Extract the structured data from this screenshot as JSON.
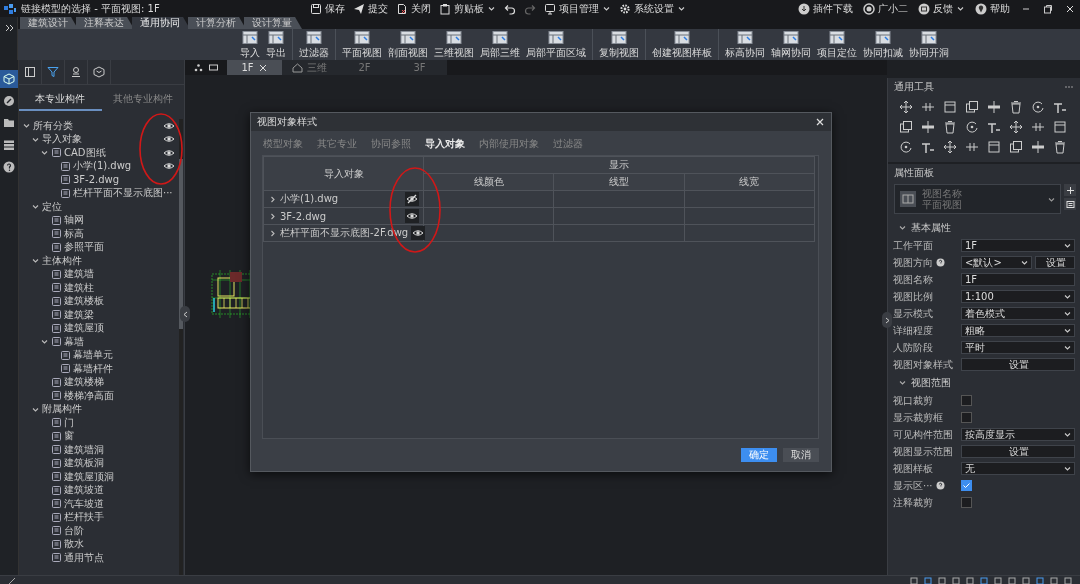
{
  "window": {
    "title": "链接模型的选择 - 平面视图: 1F"
  },
  "quick_menu": [
    {
      "kind": "save",
      "label": "保存",
      "dropdown": false,
      "disabled": false
    },
    {
      "kind": "submit",
      "label": "提交",
      "dropdown": false,
      "disabled": false
    },
    {
      "kind": "close",
      "label": "关闭",
      "dropdown": false,
      "disabled": false
    },
    {
      "kind": "clipboard",
      "label": "剪贴板",
      "dropdown": true,
      "disabled": false
    },
    {
      "kind": "undo",
      "dropdown": false,
      "disabled": false
    },
    {
      "kind": "redo",
      "dropdown": false,
      "disabled": true
    },
    {
      "kind": "project",
      "label": "项目管理",
      "dropdown": true,
      "disabled": false
    },
    {
      "kind": "settings",
      "label": "系统设置",
      "dropdown": true,
      "disabled": false
    }
  ],
  "help_menu": [
    {
      "kind": "plugin",
      "label": "插件下载",
      "dropdown": false
    },
    {
      "kind": "assistant",
      "label": "广小二",
      "dropdown": false
    },
    {
      "kind": "feedback",
      "label": "反馈",
      "dropdown": true
    },
    {
      "kind": "help",
      "label": "帮助",
      "dropdown": false
    }
  ],
  "ribbon": {
    "tabs": [
      {
        "label": "建筑设计",
        "selected": false
      },
      {
        "label": "注释表达",
        "selected": false
      },
      {
        "label": "通用协同",
        "selected": true
      },
      {
        "label": "计算分析",
        "selected": false
      },
      {
        "label": "设计算量",
        "selected": false
      }
    ],
    "groups": [
      [
        "导入",
        "导出"
      ],
      [
        "过滤器"
      ],
      [
        "平面视图",
        "剖面视图",
        "三维视图",
        "局部三维",
        "局部平面区域"
      ],
      [
        "复制视图"
      ],
      [
        "创建视图样板"
      ],
      [
        "标高协同",
        "轴网协同",
        "项目定位",
        "协同扣减",
        "协同开洞"
      ]
    ]
  },
  "nav_rail": [
    {
      "kind": "cube",
      "selected": true
    },
    {
      "kind": "link",
      "selected": false
    },
    {
      "kind": "folder",
      "selected": false
    },
    {
      "kind": "list",
      "selected": false
    },
    {
      "kind": "help",
      "selected": false
    }
  ],
  "left_panel": {
    "view_tabs": [
      {
        "kind": "layout",
        "selected": false
      },
      {
        "kind": "filter",
        "selected": true
      },
      {
        "kind": "stamp",
        "selected": false
      },
      {
        "kind": "box",
        "selected": false
      }
    ],
    "tabs": [
      {
        "label": "本专业构件",
        "selected": true
      },
      {
        "label": "其他专业构件",
        "selected": false
      }
    ],
    "tree": [
      {
        "label": "所有分类",
        "eye": true,
        "expanded": true,
        "children": [
          {
            "label": "导入对象",
            "eye": true,
            "expanded": true,
            "children": [
              {
                "label": "CAD图纸",
                "eye": true,
                "expanded": true,
                "children": [
                  {
                    "label": "小学(1).dwg",
                    "eye": true
                  },
                  {
                    "label": "3F-2.dwg",
                    "eye": false
                  },
                  {
                    "label": "栏杆平面不显示底图···",
                    "eye": false
                  }
                ]
              }
            ]
          },
          {
            "label": "定位",
            "eye": false,
            "expanded": true,
            "children": [
              {
                "label": "轴网",
                "eye": false
              },
              {
                "label": "标高",
                "eye": false
              },
              {
                "label": "参照平面",
                "eye": false
              }
            ]
          },
          {
            "label": "主体构件",
            "eye": false,
            "expanded": true,
            "children": [
              {
                "label": "建筑墙",
                "eye": false
              },
              {
                "label": "建筑柱",
                "eye": false
              },
              {
                "label": "建筑楼板",
                "eye": false
              },
              {
                "label": "建筑梁",
                "eye": false
              },
              {
                "label": "建筑屋顶",
                "eye": false
              },
              {
                "label": "幕墙",
                "eye": false,
                "expanded": true,
                "children": [
                  {
                    "label": "幕墙单元",
                    "eye": false
                  },
                  {
                    "label": "幕墙杆件",
                    "eye": false
                  }
                ]
              },
              {
                "label": "建筑楼梯",
                "eye": false
              },
              {
                "label": "楼梯净高面",
                "eye": false
              }
            ]
          },
          {
            "label": "附属构件",
            "eye": false,
            "expanded": true,
            "children": [
              {
                "label": "门",
                "eye": false
              },
              {
                "label": "窗",
                "eye": false
              },
              {
                "label": "建筑墙洞",
                "eye": false
              },
              {
                "label": "建筑板洞",
                "eye": false
              },
              {
                "label": "建筑屋顶洞",
                "eye": false
              },
              {
                "label": "建筑坡道",
                "eye": false
              },
              {
                "label": "汽车坡道",
                "eye": false
              },
              {
                "label": "栏杆扶手",
                "eye": false
              },
              {
                "label": "台阶",
                "eye": false
              },
              {
                "label": "散水",
                "eye": false
              },
              {
                "label": "通用节点",
                "eye": false
              }
            ]
          }
        ]
      }
    ]
  },
  "doc_tabs": [
    {
      "kind": "plan",
      "label": "1F",
      "selected": true,
      "closable": true
    },
    {
      "kind": "model",
      "label": "三维",
      "selected": false,
      "closable": false
    },
    {
      "kind": "plan",
      "label": "2F",
      "selected": false,
      "closable": false
    },
    {
      "kind": "plan",
      "label": "3F",
      "selected": false,
      "closable": false
    }
  ],
  "dialog": {
    "title": "视图对象样式",
    "tabs": [
      {
        "label": "模型对象",
        "selected": false
      },
      {
        "label": "其它专业",
        "selected": false
      },
      {
        "label": "协同参照",
        "selected": false
      },
      {
        "label": "导入对象",
        "selected": true
      },
      {
        "label": "内部使用对象",
        "selected": false
      },
      {
        "label": "过滤器",
        "selected": false
      }
    ],
    "table": {
      "name_column": "导入对象",
      "group_column": "显示",
      "sub_columns": [
        "线颜色",
        "线型",
        "线宽"
      ],
      "rows": [
        {
          "name": "小学(1).dwg",
          "hidden": true,
          "expanded": false
        },
        {
          "name": "3F-2.dwg",
          "hidden": false,
          "expanded": false
        },
        {
          "name": "栏杆平面不显示底图-2F.dwg",
          "hidden": false,
          "expanded": false
        }
      ]
    },
    "buttons": [
      {
        "label": "确定",
        "primary": true
      },
      {
        "label": "取消",
        "primary": false
      }
    ]
  },
  "tools": {
    "title": "通用工具"
  },
  "properties": {
    "title": "属性面板",
    "type_card": {
      "name": "视图名称",
      "type": "平面视图"
    },
    "sections": [
      {
        "title": "基本属性",
        "expanded": true,
        "rows": [
          {
            "label": "工作平面",
            "help": false,
            "kind": "select",
            "value": "1F"
          },
          {
            "label": "视图方向",
            "help": true,
            "kind": "select",
            "value": "<默认>",
            "button": "设置"
          },
          {
            "label": "视图名称",
            "help": false,
            "kind": "text",
            "value": "1F"
          },
          {
            "label": "视图比例",
            "help": false,
            "kind": "select",
            "value": "1:100"
          },
          {
            "label": "显示模式",
            "help": false,
            "kind": "select",
            "value": "着色模式"
          },
          {
            "label": "详细程度",
            "help": false,
            "kind": "select",
            "value": "粗略"
          },
          {
            "label": "人防阶段",
            "help": false,
            "kind": "select",
            "value": "平时"
          },
          {
            "label": "视图对象样式",
            "help": false,
            "kind": "button",
            "value": "设置"
          }
        ]
      },
      {
        "title": "视图范围",
        "expanded": true,
        "rows": [
          {
            "label": "视口裁剪",
            "help": false,
            "kind": "checkbox",
            "checked": false
          },
          {
            "label": "显示裁剪框",
            "help": false,
            "kind": "checkbox",
            "checked": false
          },
          {
            "label": "可见构件范围",
            "help": false,
            "kind": "select",
            "value": "按高度显示"
          },
          {
            "label": "视图显示范围",
            "help": false,
            "kind": "button",
            "value": "设置"
          },
          {
            "label": "视图样板",
            "help": false,
            "kind": "select",
            "value": "无"
          },
          {
            "label": "显示区···",
            "help": true,
            "kind": "checkbox",
            "checked": true
          },
          {
            "label": "注释裁剪",
            "help": false,
            "kind": "checkbox",
            "checked": false
          }
        ]
      }
    ]
  }
}
